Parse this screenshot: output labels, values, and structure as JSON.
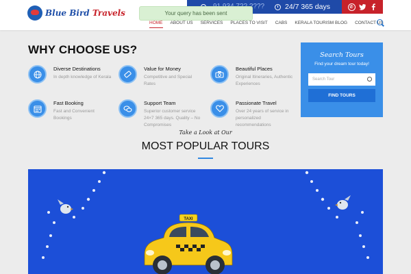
{
  "header": {
    "logo_text_a": "Blue Bird",
    "logo_text_b": "Travels",
    "phone": "91 934 7?? ????",
    "hours": "24/7 365 days",
    "social": [
      "whatsapp-icon",
      "twitter-icon",
      "facebook-icon"
    ],
    "toast": "Your query has been sent"
  },
  "nav": {
    "items": [
      "HOME",
      "ABOUT US",
      "SERVICES",
      "PLACES TO VISIT",
      "CABS",
      "KERALA TOURISM BLOG",
      "CONTACT US"
    ]
  },
  "why": {
    "title": "WHY CHOOSE US?",
    "features": [
      {
        "title": "Diverse Destinations",
        "desc": "In depth knowledge of Kerala",
        "icon": "globe-icon"
      },
      {
        "title": "Value for Money",
        "desc": "Competitive and Special Rates",
        "icon": "ticket-icon"
      },
      {
        "title": "Beautiful Places",
        "desc": "Original Itineraries, Authentic Experiences",
        "icon": "camera-icon"
      },
      {
        "title": "Fast Booking",
        "desc": "Fast and Convenient Bookings",
        "icon": "calendar-icon"
      },
      {
        "title": "Support Team",
        "desc": "Superior customer service 24×7 365 days. Quality – No Compromises",
        "icon": "chat-icon"
      },
      {
        "title": "Passionate Travel",
        "desc": "Over 24 years of service in personalized recommendations",
        "icon": "heart-icon"
      }
    ]
  },
  "search": {
    "title": "Search Tours",
    "subtitle": "Find your dream tour today!",
    "placeholder": "Search Tour",
    "button": "FIND TOURS"
  },
  "popular": {
    "kicker": "Take a Look at Our",
    "title": "MOST POPULAR TOURS",
    "taxi_sign": "TAXI"
  },
  "colors": {
    "brand_red": "#c7222a",
    "brand_blue": "#1f4aa8",
    "accent_blue": "#3a8fe8",
    "banner_blue": "#1c4fd8"
  }
}
